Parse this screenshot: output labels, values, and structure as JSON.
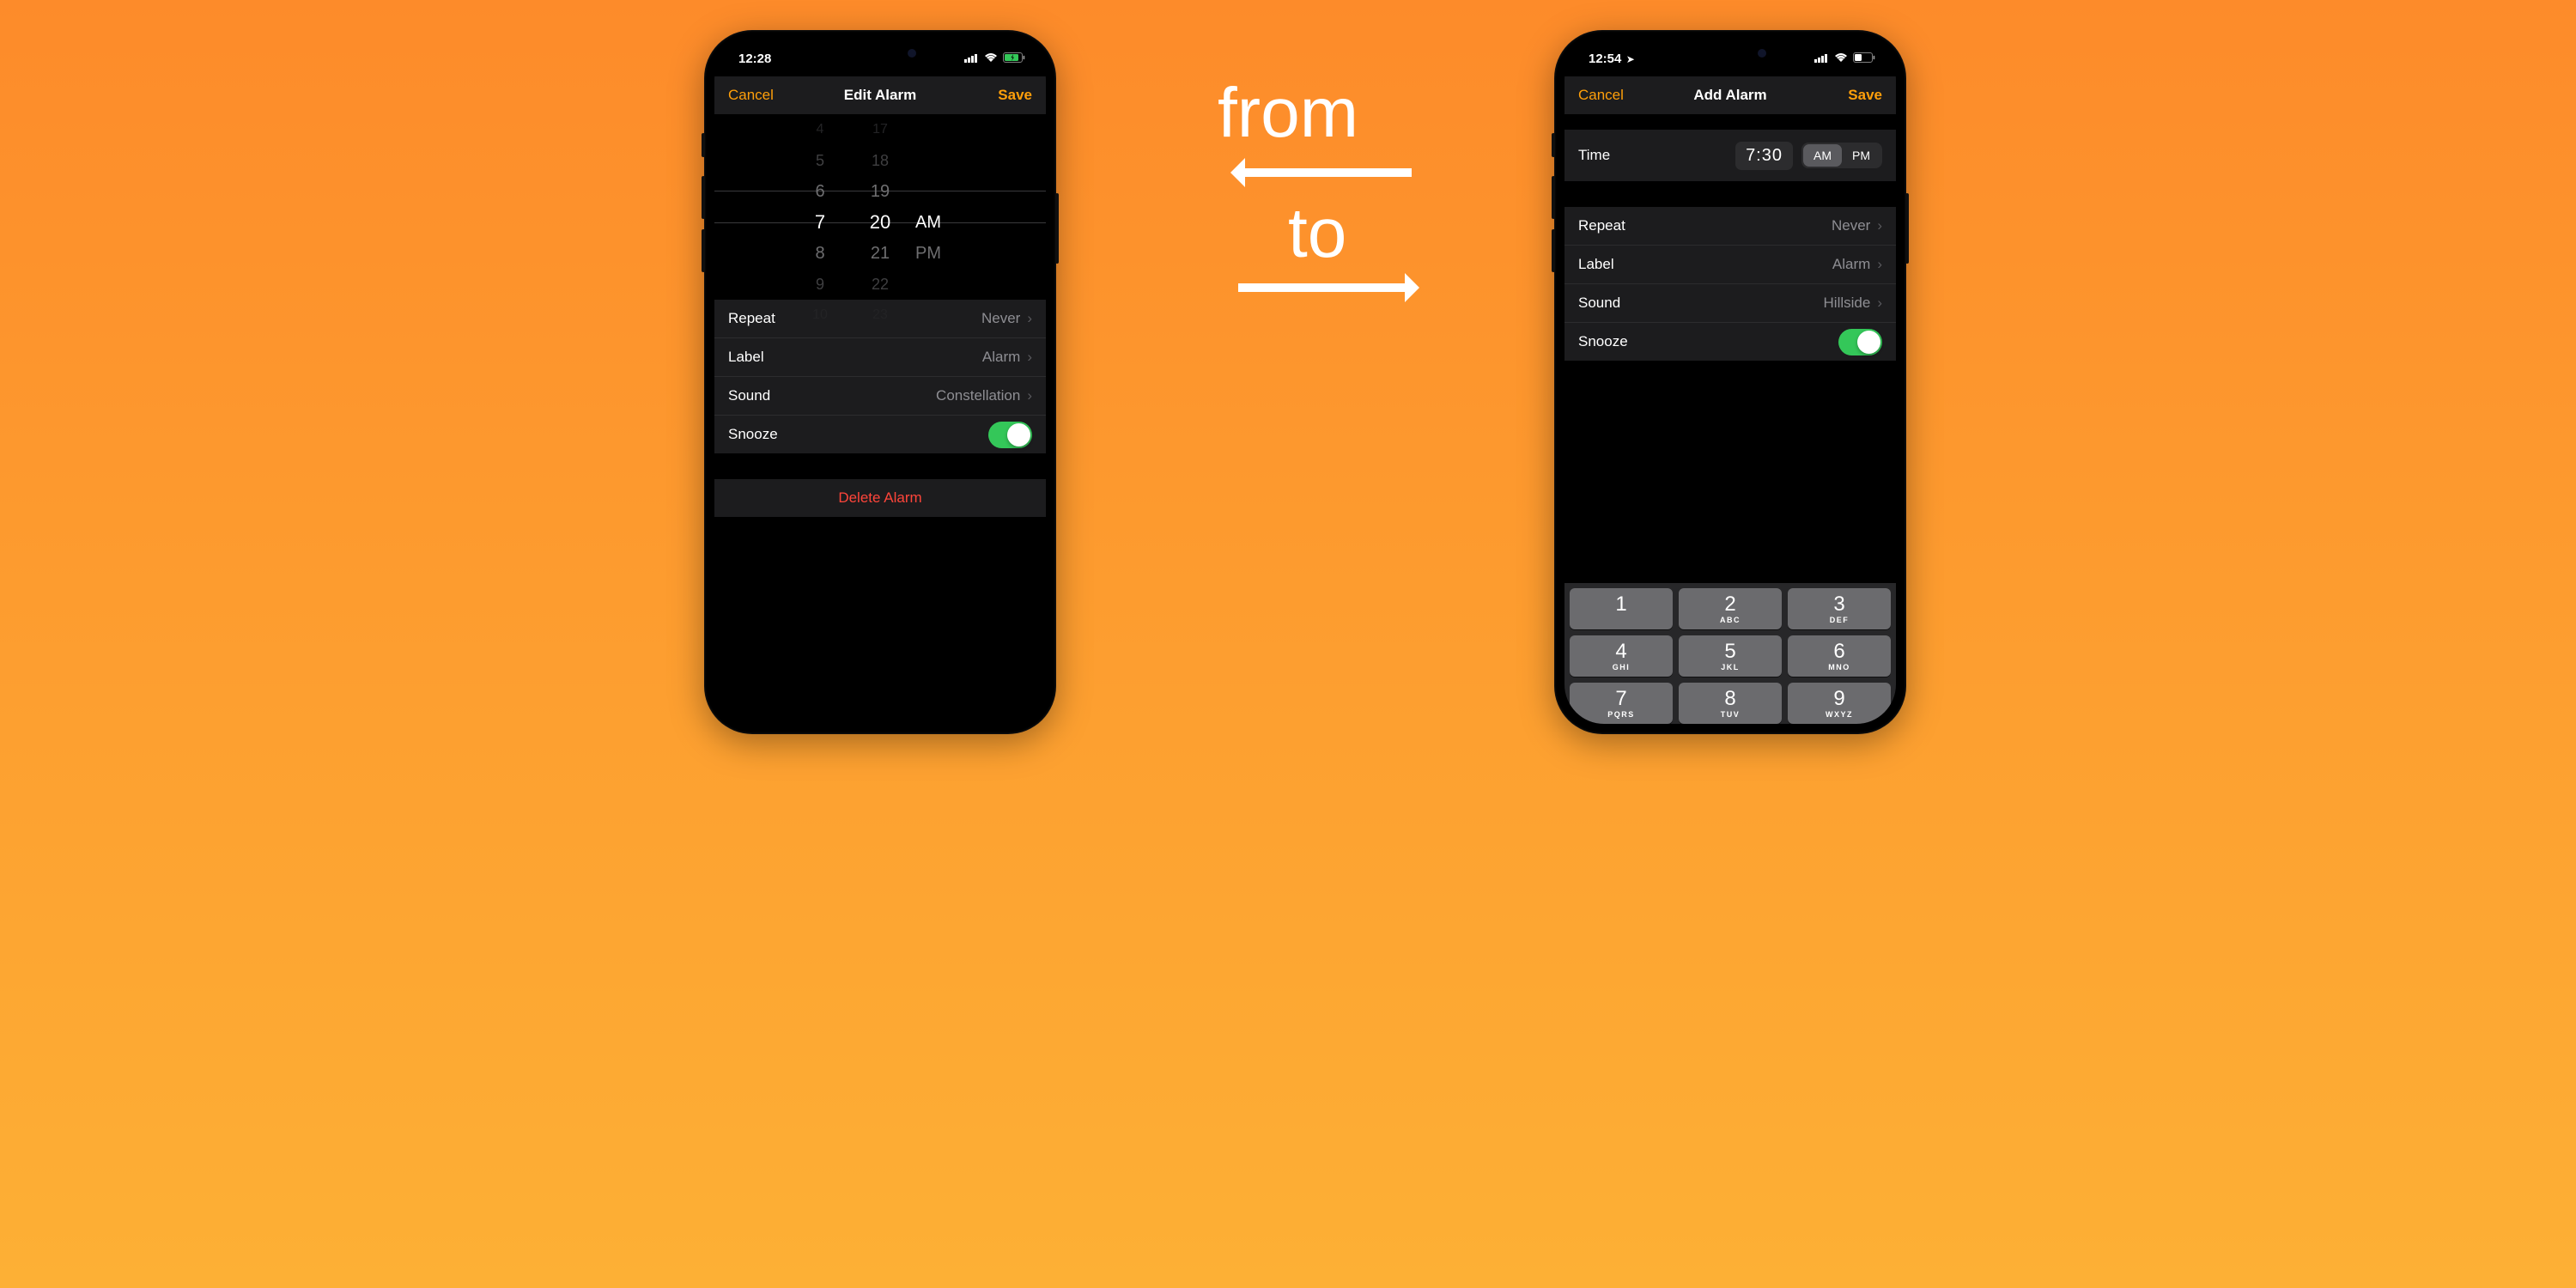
{
  "annotation": {
    "from": "from",
    "to": "to"
  },
  "left": {
    "status": {
      "time": "12:28"
    },
    "nav": {
      "cancel": "Cancel",
      "title": "Edit Alarm",
      "save": "Save"
    },
    "picker": {
      "hours": [
        "4",
        "5",
        "6",
        "7",
        "8",
        "9",
        "10"
      ],
      "mins": [
        "17",
        "18",
        "19",
        "20",
        "21",
        "22",
        "23"
      ],
      "meridiem": [
        "AM",
        "PM"
      ],
      "selected": {
        "hour": "7",
        "minute": "20",
        "meridiem": "AM"
      }
    },
    "rows": {
      "repeat": {
        "label": "Repeat",
        "value": "Never"
      },
      "label": {
        "label": "Label",
        "value": "Alarm"
      },
      "sound": {
        "label": "Sound",
        "value": "Constellation"
      },
      "snooze": {
        "label": "Snooze",
        "on": true
      }
    },
    "delete": "Delete Alarm"
  },
  "right": {
    "status": {
      "time": "12:54"
    },
    "nav": {
      "cancel": "Cancel",
      "title": "Add Alarm",
      "save": "Save"
    },
    "time": {
      "label": "Time",
      "value": "7:30",
      "am": "AM",
      "pm": "PM",
      "selected": "AM"
    },
    "rows": {
      "repeat": {
        "label": "Repeat",
        "value": "Never"
      },
      "label": {
        "label": "Label",
        "value": "Alarm"
      },
      "sound": {
        "label": "Sound",
        "value": "Hillside"
      },
      "snooze": {
        "label": "Snooze",
        "on": true
      }
    },
    "keypad": [
      {
        "n": "1",
        "l": ""
      },
      {
        "n": "2",
        "l": "ABC"
      },
      {
        "n": "3",
        "l": "DEF"
      },
      {
        "n": "4",
        "l": "GHI"
      },
      {
        "n": "5",
        "l": "JKL"
      },
      {
        "n": "6",
        "l": "MNO"
      },
      {
        "n": "7",
        "l": "PQRS"
      },
      {
        "n": "8",
        "l": "TUV"
      },
      {
        "n": "9",
        "l": "WXYZ"
      }
    ]
  }
}
